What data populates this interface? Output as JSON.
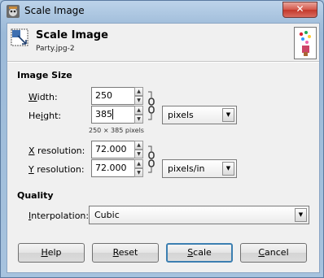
{
  "window": {
    "title": "Scale Image",
    "close_glyph": "✕"
  },
  "header": {
    "title": "Scale Image",
    "subtitle": "Party.jpg-2",
    "icon": "scale-image-icon"
  },
  "image_size": {
    "section_label": "Image Size",
    "width": {
      "label_mnemonic": "W",
      "label_rest": "idth:",
      "value": "250"
    },
    "height": {
      "label_pre": "He",
      "label_mnemonic": "i",
      "label_rest": "ght:",
      "value": "385"
    },
    "size_hint": "250 × 385 pixels",
    "unit": "pixels",
    "x_resolution": {
      "label_mnemonic": "X",
      "label_rest": " resolution:",
      "value": "72.000"
    },
    "y_resolution": {
      "label_mnemonic": "Y",
      "label_rest": " resolution:",
      "value": "72.000"
    },
    "resolution_unit": "pixels/in",
    "chain_linked": true
  },
  "quality": {
    "section_label": "Quality",
    "interpolation": {
      "label_mnemonic": "I",
      "label_rest": "nterpolation:",
      "value": "Cubic"
    }
  },
  "buttons": {
    "help": {
      "mnemonic": "H",
      "rest": "elp"
    },
    "reset": {
      "mnemonic": "R",
      "rest": "eset"
    },
    "scale": {
      "mnemonic": "S",
      "rest": "cale"
    },
    "cancel": {
      "mnemonic": "C",
      "rest": "ancel"
    }
  }
}
